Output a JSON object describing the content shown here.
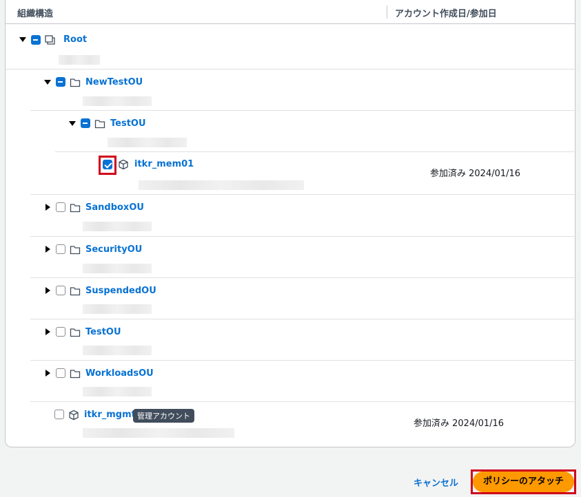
{
  "header": {
    "col_structure": "組織構造",
    "col_date": "アカウント作成日/参加日"
  },
  "tree": {
    "root": {
      "label": "Root"
    },
    "new_test_ou": {
      "label": "NewTestOU"
    },
    "test_ou_child": {
      "label": "TestOU"
    },
    "itkr_mem01": {
      "label": "itkr_mem01",
      "date": "参加済み 2024/01/16"
    },
    "sandbox_ou": {
      "label": "SandboxOU"
    },
    "security_ou": {
      "label": "SecurityOU"
    },
    "suspended_ou": {
      "label": "SuspendedOU"
    },
    "test_ou": {
      "label": "TestOU"
    },
    "workloads_ou": {
      "label": "WorkloadsOU"
    },
    "itkr_mgmt": {
      "label": "itkr_mgmt",
      "badge": "管理アカウント",
      "date": "参加済み 2024/01/16"
    }
  },
  "footer": {
    "cancel_label": "キャンセル",
    "attach_label": "ポリシーのアタッチ"
  },
  "colors": {
    "link": "#0972d3",
    "primary": "#ff9900",
    "highlight": "#d0021b"
  }
}
